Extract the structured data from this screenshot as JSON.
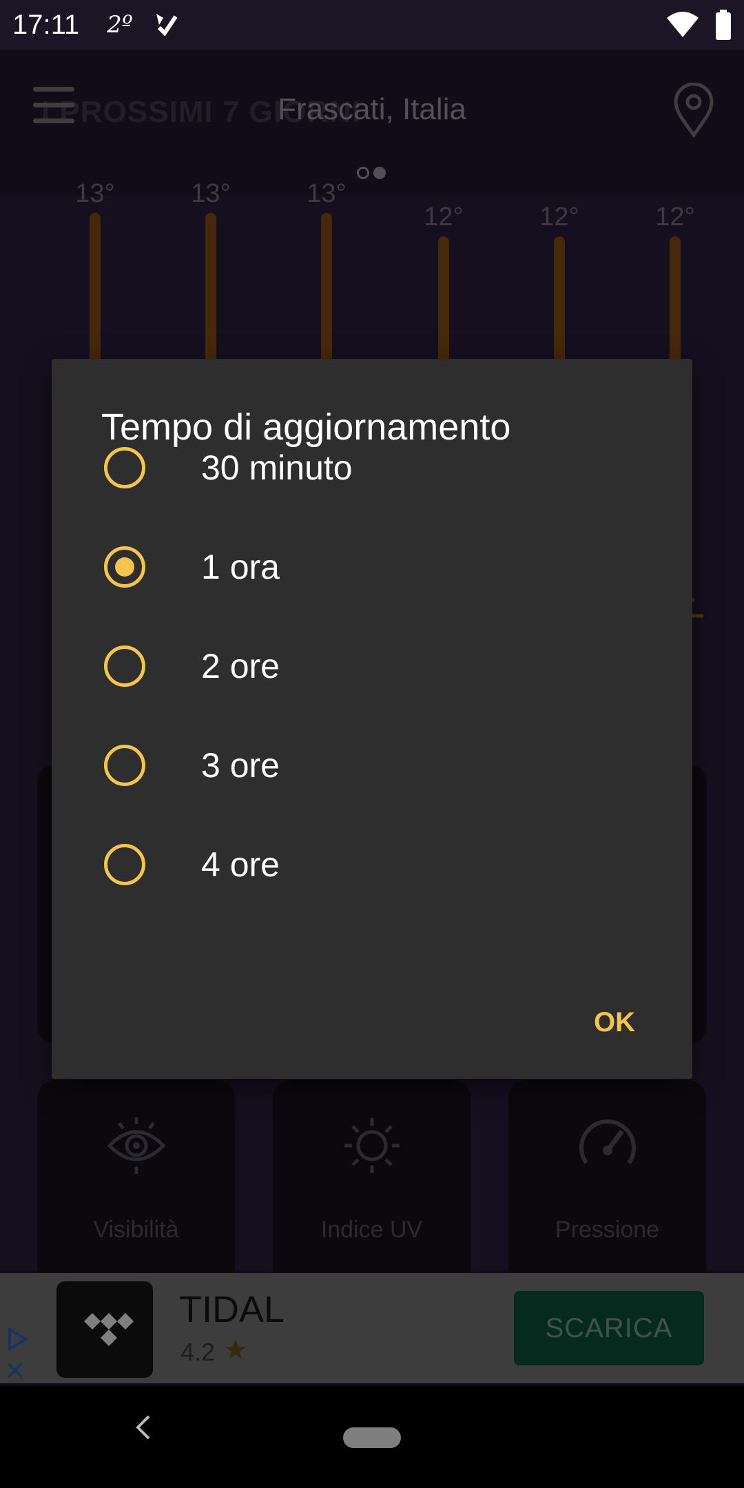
{
  "status_bar": {
    "time": "17:11",
    "temperature": "2º"
  },
  "header": {
    "ghost_title": "I PROSSIMI 7 GIORNI",
    "location": "Frascati, Italia"
  },
  "forecast": {
    "temperatures": [
      "13°",
      "13°",
      "13°",
      "12°",
      "12°",
      "12°"
    ]
  },
  "cards": [
    {
      "label": "Visibilità",
      "icon": "eye-icon"
    },
    {
      "label": "Indice UV",
      "icon": "sun-icon"
    },
    {
      "label": "Pressione",
      "icon": "gauge-icon"
    }
  ],
  "ad": {
    "app_name": "TIDAL",
    "rating": "4.2",
    "cta": "SCARICA"
  },
  "dialog": {
    "title": "Tempo di aggiornamento",
    "options": [
      {
        "label": "30 minuto",
        "selected": false
      },
      {
        "label": "1 ora",
        "selected": true
      },
      {
        "label": "2 ore",
        "selected": false
      },
      {
        "label": "3 ore",
        "selected": false
      },
      {
        "label": "4 ore",
        "selected": false
      }
    ],
    "ok_label": "OK"
  },
  "colors": {
    "accent": "#f5c44e",
    "dialog_bg": "#2e2e2e",
    "ad_button": "#0c4a35"
  }
}
